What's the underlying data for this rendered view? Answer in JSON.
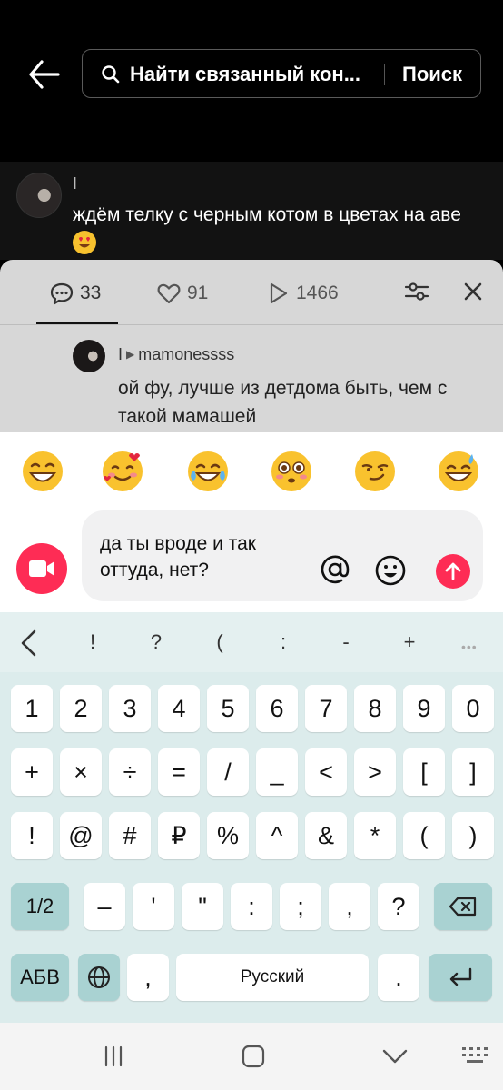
{
  "search": {
    "query": "Найти связанный кон...",
    "button_label": "Поиск"
  },
  "parent_comment": {
    "username": "I",
    "text": "ждём телку с черным котом в цветах на аве"
  },
  "tabs": {
    "comments_count": "33",
    "likes_count": "91",
    "views_count": "1466"
  },
  "reply": {
    "author": "I",
    "reply_to": "mamonessss",
    "text": "ой фу, лучше из детдома быть, чем с такой мамашей"
  },
  "emoji_bar": [
    "grinning",
    "smiling-hearts",
    "tears-of-joy",
    "flushed",
    "smirk",
    "sweat-smile"
  ],
  "input": {
    "value": "да ты вроде и так оттуда, нет?"
  },
  "keyboard": {
    "toolbar": [
      "!",
      "?",
      "(",
      ":",
      "-",
      "+"
    ],
    "row1": [
      "1",
      "2",
      "3",
      "4",
      "5",
      "6",
      "7",
      "8",
      "9",
      "0"
    ],
    "row2": [
      "+",
      "×",
      "÷",
      "=",
      "/",
      "_",
      "<",
      ">",
      "[",
      "]"
    ],
    "row3": [
      "!",
      "@",
      "#",
      "₽",
      "%",
      "^",
      "&",
      "*",
      "(",
      ")"
    ],
    "row4_shift": "1/2",
    "row4": [
      "–",
      "'",
      "\"",
      ":",
      ";",
      ",",
      "?"
    ],
    "lang_key": "АБВ",
    "comma_key": ",",
    "space_label": "Русский",
    "period_key": "."
  },
  "colors": {
    "accent": "#fe2c55",
    "keyboard_bg": "#dcecec",
    "function_key": "#a9d2d2"
  }
}
